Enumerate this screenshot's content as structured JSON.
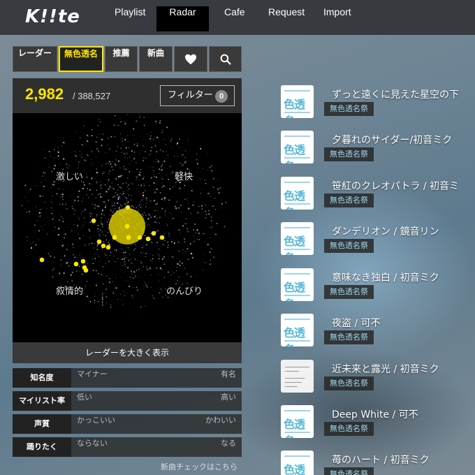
{
  "header": {
    "logo": "K!!te",
    "nav": [
      "Playlist",
      "Radar",
      "Cafe",
      "Request",
      "Import"
    ],
    "active_nav": "Radar"
  },
  "tabs": {
    "radar": "レーダー",
    "mushoku": "無色透名",
    "recommend": "推薦",
    "new": "新曲"
  },
  "counter": {
    "count": "2,982",
    "total": "/  388,527"
  },
  "filter": {
    "label": "フィルター",
    "badge": "0"
  },
  "radar": {
    "q_tl": "激しい",
    "q_tr": "軽快",
    "q_bl": "叙情的",
    "q_br": "のんびり",
    "expand_label": "レーダーを大きく表示"
  },
  "sliders": [
    {
      "label": "知名度",
      "low": "マイナー",
      "high": "有名"
    },
    {
      "label": "マイリスト率",
      "low": "低い",
      "high": "高い"
    },
    {
      "label": "声質",
      "low": "かっこいい",
      "high": "かわいい"
    },
    {
      "label": "踊りたく",
      "low": "ならない",
      "high": "なる"
    }
  ],
  "new_check": "新曲チェックはこちら",
  "songs": [
    {
      "title": "ずっと遠くに見えた星空の下",
      "tag": "無色透名祭",
      "thumb": "色透名"
    },
    {
      "title": "夕暮れのサイダー/初音ミク",
      "tag": "無色透名祭",
      "thumb": "色透名"
    },
    {
      "title": "笹紅のクレオパトラ / 初音ミ",
      "tag": "無色透名祭",
      "thumb": "色透名"
    },
    {
      "title": "ダンデリオン / 鏡音リン",
      "tag": "無色透名祭",
      "thumb": "色透名"
    },
    {
      "title": "意味なき独白 / 初音ミク",
      "tag": "無色透名祭",
      "thumb": "色透名"
    },
    {
      "title": "夜盗 / 可不",
      "tag": "無色透名祭",
      "thumb": "色透名"
    },
    {
      "title": "近未来と露光 / 初音ミク",
      "tag": "無色透名祭",
      "thumb": ""
    },
    {
      "title": "Deep White / 可不",
      "tag": "無色透名祭",
      "thumb": "色透名"
    },
    {
      "title": "苺のハート / 初音ミク",
      "tag": "無色透名祭",
      "thumb": "色透名"
    }
  ],
  "colors": {
    "accent": "#ffe600",
    "tag_text": "#9fd6ea"
  }
}
